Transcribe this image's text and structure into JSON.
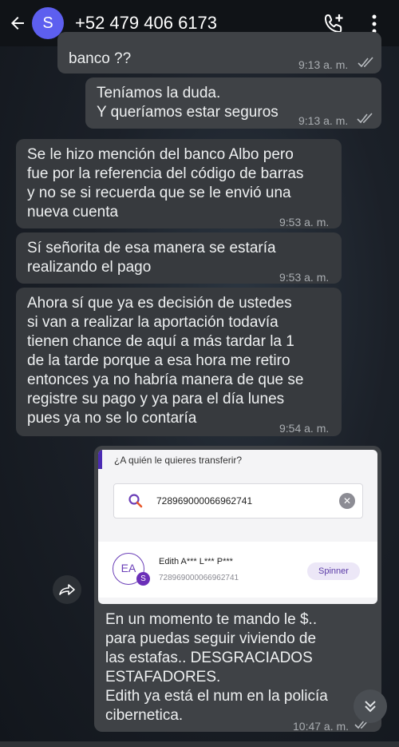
{
  "header": {
    "avatar_letter": "S",
    "contact": "+52 479 406 6173",
    "icons": [
      "back-arrow-icon",
      "add-call-icon",
      "more-vert-icon"
    ]
  },
  "messages": [
    {
      "id": "m1",
      "direction": "outgoing",
      "text": "banco ??",
      "time": "9:13 a. m.",
      "read": true
    },
    {
      "id": "m2",
      "direction": "outgoing",
      "text": "Teníamos la duda.\nY queríamos estar seguros",
      "time": "9:13 a. m.",
      "read": true
    },
    {
      "id": "m3",
      "direction": "incoming",
      "text": "Se le hizo mención del banco Albo pero\nfue por la referencia del código de barras\ny no se si recuerda que se le envió una\nnueva cuenta",
      "time": "9:53 a. m."
    },
    {
      "id": "m4",
      "direction": "incoming",
      "text": "Sí señorita de esa manera se estaría\nrealizando el pago",
      "time": "9:53 a. m."
    },
    {
      "id": "m5",
      "direction": "incoming",
      "text": "Ahora sí que ya es decisión de ustedes\nsi van a realizar la aportación todavía\ntienen chance de aquí a más tardar la 1\nde la tarde porque a esa hora me retiro\nentonces ya no habría manera de que se\nregistre su pago y ya para el día lunes\npues ya no se lo contaría",
      "time": "9:54 a. m."
    },
    {
      "id": "m6",
      "direction": "outgoing",
      "text": "En un momento te mando le $..\npara puedas seguir viviendo de\nlas estafas.. DESGRACIADOS\nESTAFADORES.\nEdith ya está el num en la policía\ncibernetica.",
      "time": "10:47 a. m.",
      "read": true
    }
  ],
  "attachment": {
    "question": "¿A quién le quieres transferir?",
    "search_value": "728969000066962741",
    "result_initials": "EA",
    "result_badge": "S",
    "result_name": "Edith A*** L*** P***",
    "result_account": "728969000066962741",
    "result_tag": "Spinner"
  },
  "colors": {
    "avatar": "#5d5fef",
    "incoming_bubble": "#373a3e",
    "outgoing_bubble": "#3f4246",
    "accent_purple": "#6b2fb8"
  }
}
